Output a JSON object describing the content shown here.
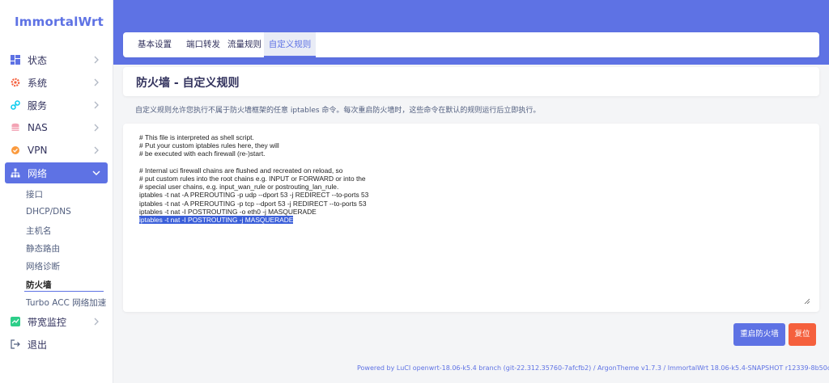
{
  "app": {
    "logo": "ImmortalWrt"
  },
  "sidebar": {
    "items": [
      {
        "label": "状态",
        "icon": "dashboard-icon",
        "color": "#5e72e4"
      },
      {
        "label": "系统",
        "icon": "gear-icon",
        "color": "#f5603d"
      },
      {
        "label": "服务",
        "icon": "link-icon",
        "color": "#11cdef"
      },
      {
        "label": "NAS",
        "icon": "database-icon",
        "color": "#f3a4b5"
      },
      {
        "label": "VPN",
        "icon": "shield-icon",
        "color": "#fb9a3d"
      },
      {
        "label": "网络",
        "icon": "network-icon",
        "color": "#ffffff"
      },
      {
        "label": "带宽监控",
        "icon": "chart-icon",
        "color": "#2dce89"
      },
      {
        "label": "退出",
        "icon": "logout-icon",
        "color": "#525f7f"
      }
    ],
    "network_sub": [
      {
        "label": "接口"
      },
      {
        "label": "DHCP/DNS"
      },
      {
        "label": "主机名"
      },
      {
        "label": "静态路由"
      },
      {
        "label": "网络诊断"
      },
      {
        "label": "防火墙"
      },
      {
        "label": "Turbo ACC 网络加速"
      }
    ]
  },
  "tabs": [
    {
      "label": "基本设置"
    },
    {
      "label": "端口转发"
    },
    {
      "label": "流量规则"
    },
    {
      "label": "自定义规则"
    }
  ],
  "page": {
    "title": "防火墙 - 自定义规则",
    "description": "自定义规则允许您执行不属于防火墙框架的任意 iptables 命令。每次重启防火墙时，这些命令在默认的规则运行后立即执行。"
  },
  "editor": {
    "lines": [
      "# This file is interpreted as shell script.",
      "# Put your custom iptables rules here, they will",
      "# be executed with each firewall (re-)start.",
      "",
      "# Internal uci firewall chains are flushed and recreated on reload, so",
      "# put custom rules into the root chains e.g. INPUT or FORWARD or into the",
      "# special user chains, e.g. input_wan_rule or postrouting_lan_rule.",
      "iptables -t nat -A PREROUTING -p udp --dport 53 -j REDIRECT --to-ports 53",
      "iptables -t nat -A PREROUTING -p tcp --dport 53 -j REDIRECT --to-ports 53",
      "iptables -t nat -I POSTROUTING -o eth0 -j MASQUERADE",
      "iptables -t nat -I POSTROUTING -j MASQUERADE"
    ]
  },
  "buttons": {
    "restart": "重启防火墙",
    "reset": "复位"
  },
  "footer": {
    "text": "Powered by LuCI openwrt-18.06-k5.4 branch (git-22.312.35760-7afcfb2) / ArgonTheme v1.7.3 / ImmortalWrt 18.06-k5.4-SNAPSHOT r12339-8b50c1df21"
  }
}
